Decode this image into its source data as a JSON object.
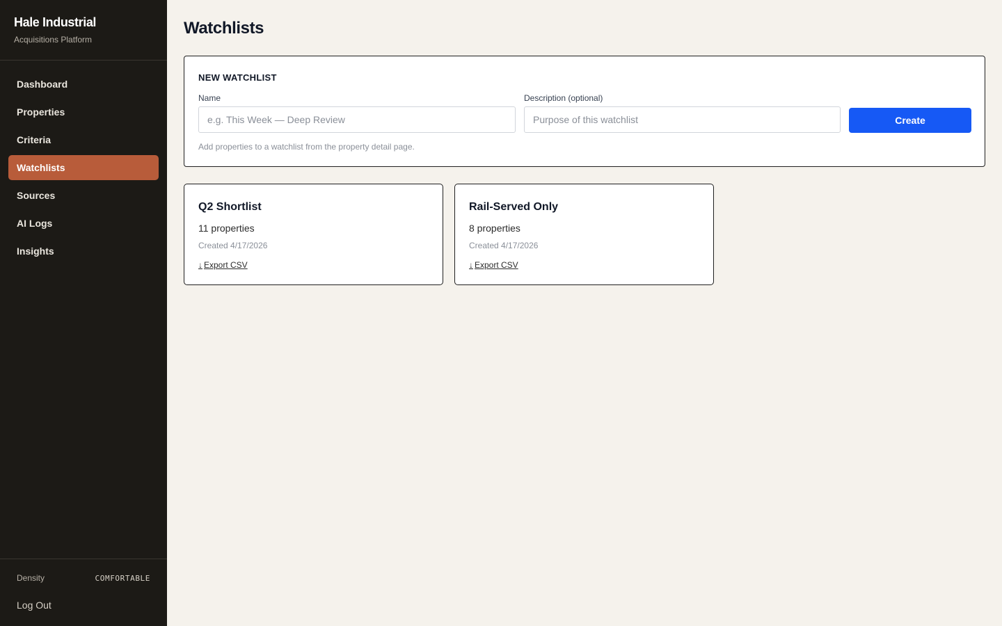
{
  "brand": {
    "title": "Hale Industrial",
    "subtitle": "Acquisitions Platform"
  },
  "nav": {
    "items": [
      {
        "label": "Dashboard",
        "active": false
      },
      {
        "label": "Properties",
        "active": false
      },
      {
        "label": "Criteria",
        "active": false
      },
      {
        "label": "Watchlists",
        "active": true
      },
      {
        "label": "Sources",
        "active": false
      },
      {
        "label": "AI Logs",
        "active": false
      },
      {
        "label": "Insights",
        "active": false
      }
    ]
  },
  "footer": {
    "density_label": "Density",
    "density_value": "COMFORTABLE",
    "logout_label": "Log Out"
  },
  "page": {
    "title": "Watchlists"
  },
  "new_watchlist": {
    "title": "NEW WATCHLIST",
    "name_label": "Name",
    "name_placeholder": "e.g. This Week — Deep Review",
    "name_value": "",
    "description_label": "Description (optional)",
    "description_placeholder": "Purpose of this watchlist",
    "description_value": "",
    "create_label": "Create",
    "hint": "Add properties to a watchlist from the property detail page."
  },
  "watchlists": [
    {
      "name": "Q2 Shortlist",
      "count_text": "11 properties",
      "created_text": "Created 4/17/2026",
      "export_label": "Export CSV"
    },
    {
      "name": "Rail-Served Only",
      "count_text": "8 properties",
      "created_text": "Created 4/17/2026",
      "export_label": "Export CSV"
    }
  ],
  "colors": {
    "accent": "#b85c3a",
    "primary_button": "#1659f5",
    "sidebar_bg": "#1c1a16",
    "page_bg": "#f5f2ec"
  },
  "icons": {
    "export": "arrow-down-icon"
  }
}
